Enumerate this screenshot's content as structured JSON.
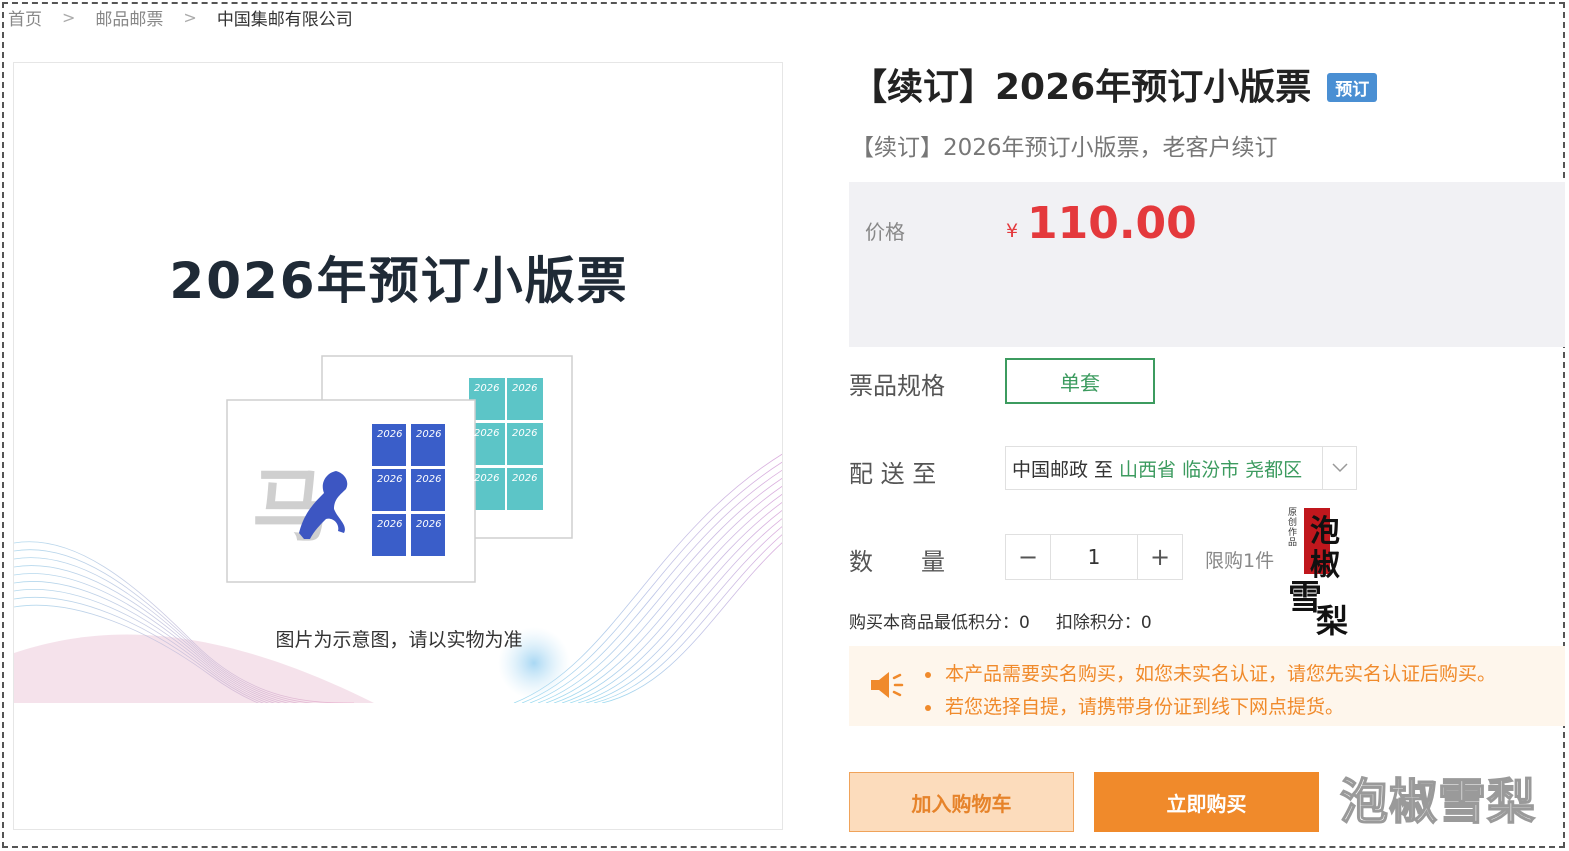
{
  "breadcrumb": {
    "home": "首页",
    "category": "邮品邮票",
    "current": "中国集邮有限公司"
  },
  "product_image": {
    "title": "2026年预订小版票",
    "caption": "图片为示意图，请以实物为准",
    "stamp_year_text": "2026",
    "stamp_char": "马"
  },
  "product": {
    "title": "【续订】2026年预订小版票",
    "tag": "预订",
    "subtitle": "【续订】2026年预订小版票，老客户续订"
  },
  "price": {
    "label": "价格",
    "currency": "¥",
    "value": "110.00"
  },
  "spec": {
    "label": "票品规格",
    "selected": "单套"
  },
  "shipping": {
    "label": "配 送 至",
    "carrier": "中国邮政 至",
    "destination": "山西省 临汾市 尧都区"
  },
  "quantity": {
    "label": "数　　量",
    "minus": "−",
    "value": "1",
    "plus": "+",
    "limit": "限购1件"
  },
  "points": {
    "min_points": "购买本商品最低积分：0",
    "deduct_points": "扣除积分：0"
  },
  "notices": [
    "本产品需要实名购买，如您未实名认证，请您先实名认证后购买。",
    "若您选择自提，请携带身份证到线下网点提货。"
  ],
  "actions": {
    "add_to_cart": "加入购物车",
    "buy_now": "立即购买"
  },
  "watermark": {
    "seal_small": "原创作品",
    "seal_chars": [
      "泡",
      "椒",
      "雪",
      "梨"
    ],
    "text": "泡椒雪梨"
  },
  "colors": {
    "accent_orange": "#f08a2b",
    "price_red": "#e4393c",
    "spec_green": "#3c9b5f",
    "tag_blue": "#4a8fd3"
  }
}
